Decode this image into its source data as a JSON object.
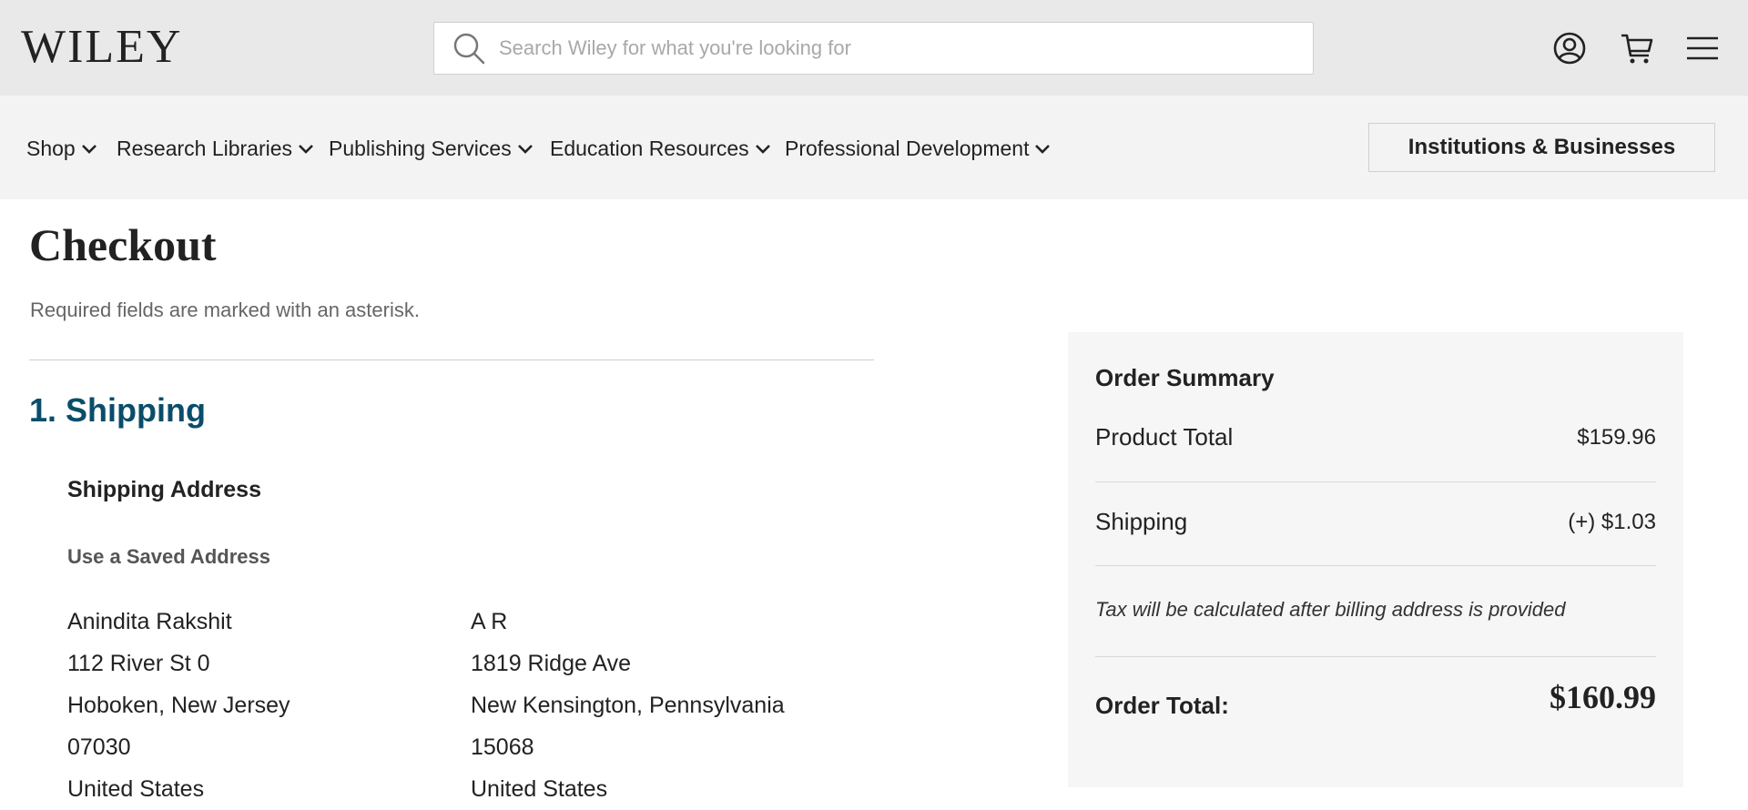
{
  "header": {
    "logo_text": "WILEY",
    "search_placeholder": "Search Wiley for what you're looking for",
    "icons": [
      "account-icon",
      "cart-icon",
      "menu-icon"
    ]
  },
  "nav": {
    "items": [
      {
        "label": "Shop"
      },
      {
        "label": "Research Libraries"
      },
      {
        "label": "Publishing Services"
      },
      {
        "label": "Education Resources"
      },
      {
        "label": "Professional Development"
      }
    ],
    "institutions_button": "Institutions & Businesses"
  },
  "main": {
    "title": "Checkout",
    "required_note": "Required fields are marked with an asterisk.",
    "section_title": "1. Shipping",
    "shipping_address_label": "Shipping Address",
    "saved_address_label": "Use a Saved Address",
    "addresses": [
      {
        "name": "Anindita Rakshit",
        "street": "112 River St 0",
        "city_state": "Hoboken, New Jersey",
        "zip": "07030",
        "country": "United States"
      },
      {
        "name": "A R",
        "street": "1819 Ridge Ave",
        "city_state": "New Kensington, Pennsylvania",
        "zip": "15068",
        "country": "United States"
      }
    ]
  },
  "summary": {
    "title": "Order Summary",
    "product_total_label": "Product Total",
    "product_total_value": "$159.96",
    "shipping_label": "Shipping",
    "shipping_value": "(+) $1.03",
    "tax_note": "Tax will be calculated after billing address is provided",
    "order_total_label": "Order Total:",
    "order_total_value": "$160.99"
  },
  "colors": {
    "header_bg": "#e9e9e9",
    "nav_bg": "#f3f3f3",
    "section_accent": "#0a4d6a",
    "summary_bg": "#f6f6f6"
  }
}
